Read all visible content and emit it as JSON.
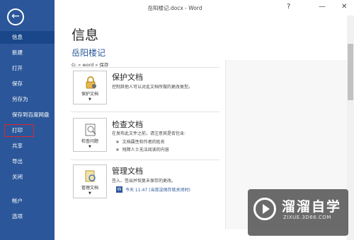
{
  "window": {
    "title": "岳阳楼记.docx - Word",
    "help": "?",
    "minimize": "—",
    "close": "✕"
  },
  "sidebar": {
    "back_icon": "←",
    "items": [
      {
        "label": "信息"
      },
      {
        "label": "新建"
      },
      {
        "label": "打开"
      },
      {
        "label": "保存"
      },
      {
        "label": "另存为"
      },
      {
        "label": "保存到百度网盘"
      },
      {
        "label": "打印"
      },
      {
        "label": "共享"
      },
      {
        "label": "导出"
      },
      {
        "label": "关闭"
      },
      {
        "label": "帐户"
      },
      {
        "label": "选项"
      }
    ]
  },
  "main": {
    "title": "信息",
    "doc_name": "岳阳楼记",
    "doc_path": "G: » word » 保存",
    "sections": [
      {
        "button": "保护文档",
        "title": "保护文档",
        "desc": "控制其他人可以对此文档所做的更改类型。"
      },
      {
        "button": "检查问题",
        "title": "检查文档",
        "desc": "在发布此文件之前，请注意其是否包含:",
        "bullets": [
          "文档属性和作者的姓名",
          "残障人士无法阅读的内容"
        ]
      },
      {
        "button": "管理文档",
        "title": "管理文档",
        "desc": "签入、签出并恢复未保存的更改。",
        "version": "今天 11:47 (当我没保存就关闭时)"
      }
    ]
  },
  "watermark": {
    "main": "溜溜自学",
    "sub": "ZIXUE.3D66.COM"
  },
  "colors": {
    "sidebar": "#2b579a",
    "accent": "#2b579a",
    "highlight": "#e0262d"
  }
}
